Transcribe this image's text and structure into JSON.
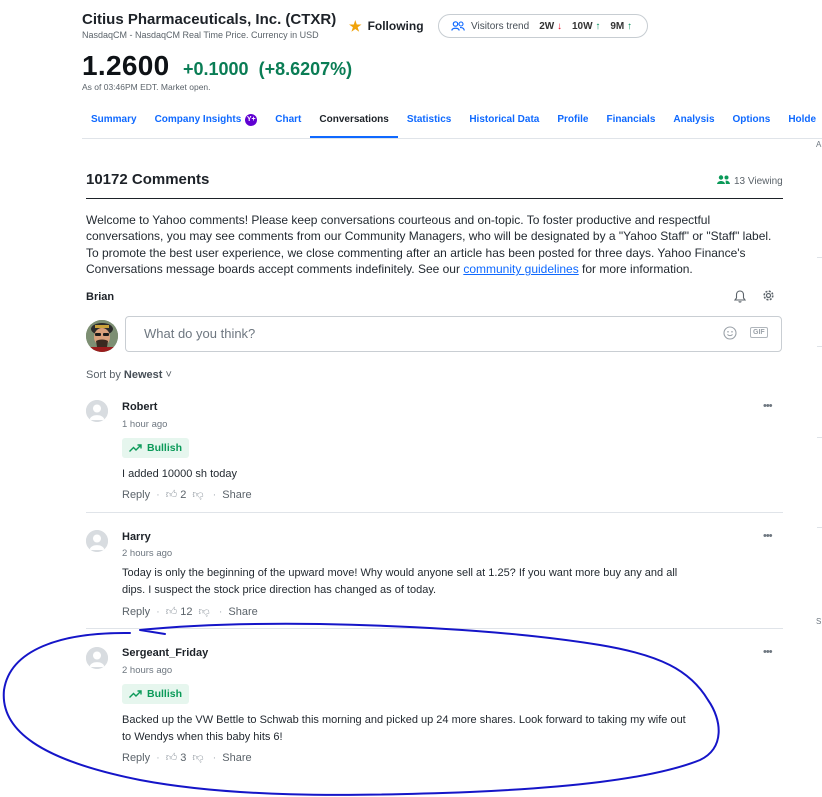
{
  "header": {
    "company": "Citius Pharmaceuticals, Inc. (CTXR)",
    "subline": "NasdaqCM - NasdaqCM Real Time Price. Currency in USD",
    "follow_label": "Following",
    "visitors_label": "Visitors trend",
    "trends": [
      {
        "label": "2W",
        "arrow": "↓",
        "direction": "down"
      },
      {
        "label": "10W",
        "arrow": "↑",
        "direction": "up"
      },
      {
        "label": "9M",
        "arrow": "↑",
        "direction": "up"
      }
    ],
    "price": "1.2600",
    "change": "+0.1000",
    "change_pct": "(+8.6207%)",
    "as_of": "As of 03:46PM EDT. Market open."
  },
  "nav": {
    "tabs": [
      "Summary",
      "Company Insights",
      "Chart",
      "Conversations",
      "Statistics",
      "Historical Data",
      "Profile",
      "Financials",
      "Analysis",
      "Options",
      "Holde"
    ],
    "active": "Conversations",
    "insights_badge": "Y+"
  },
  "edge_fragments": [
    "A",
    "S"
  ],
  "conversation": {
    "title": "10172 Comments",
    "viewing": "13 Viewing",
    "welcome_text": "Welcome to Yahoo comments! Please keep conversations courteous and on-topic. To foster productive and respectful conversations, you may see comments from our Community Managers, who will be designated by a \"Yahoo Staff\" or \"Staff\" label. To promote the best user experience, we close commenting after an article has been posted for three days. Yahoo Finance's Conversations message boards accept comments indefinitely. See our ",
    "guidelines_link": "community guidelines",
    "welcome_tail": " for more information.",
    "username": "Brian",
    "input_placeholder": "What do you think?",
    "gif_label": "GIF",
    "sort_prefix": "Sort by ",
    "sort_value": "Newest"
  },
  "comments": [
    {
      "name": "Robert",
      "time": "1 hour ago",
      "sentiment": "Bullish",
      "text": "I added 10000 sh today",
      "likes": "2",
      "reply": "Reply",
      "share": "Share"
    },
    {
      "name": "Harry",
      "time": "2 hours ago",
      "sentiment": "",
      "text": "Today is only the beginning of the upward move! Why would anyone sell at 1.25? If you want more buy any and all dips. I suspect the stock price direction has changed as of today.",
      "likes": "12",
      "reply": "Reply",
      "share": "Share"
    },
    {
      "name": "Sergeant_Friday",
      "time": "2 hours ago",
      "sentiment": "Bullish",
      "text": "Backed up the VW Bettle to Schwab this morning and picked up 24 more shares. Look forward to taking my wife out to Wendys when this baby hits 6!",
      "likes": "3",
      "reply": "Reply",
      "share": "Share"
    }
  ],
  "colors": {
    "link": "#0f69ff",
    "positive": "#0a7d55",
    "negative": "#eb0f29",
    "bullish_bg": "#e6f6ee",
    "bullish_text": "#0b9a59",
    "annotation": "#1515c8"
  }
}
